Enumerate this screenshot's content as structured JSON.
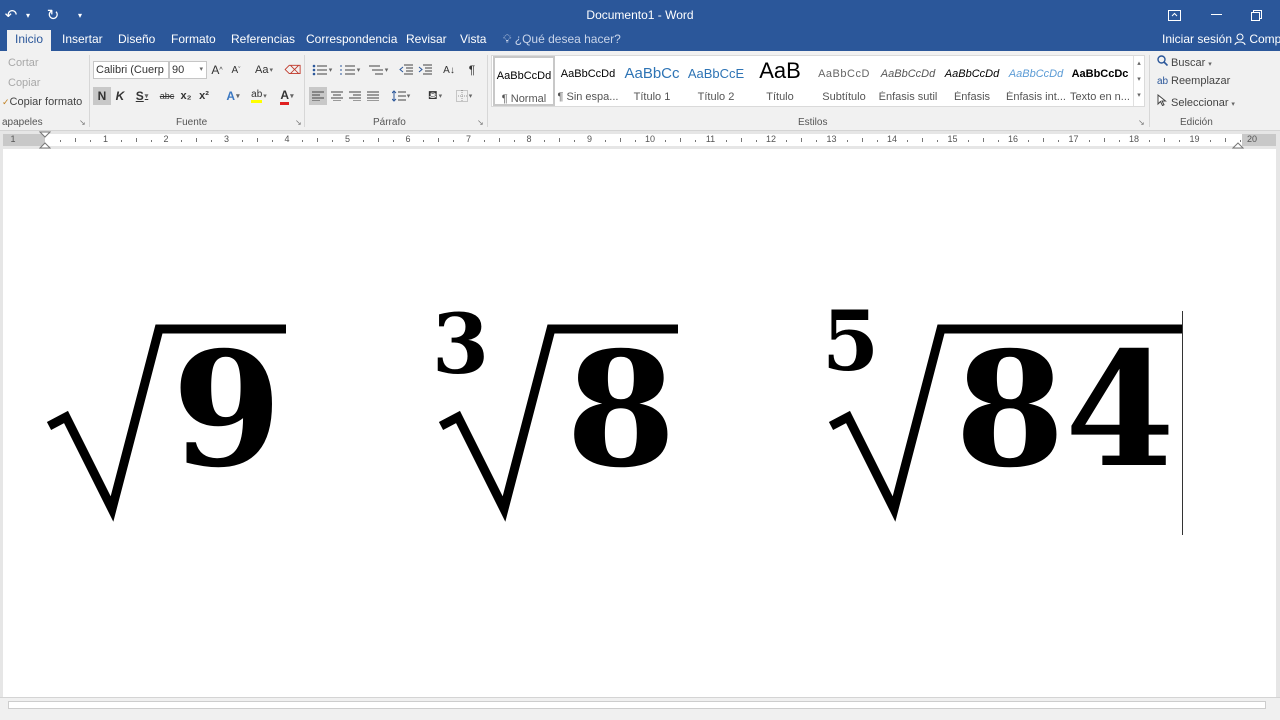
{
  "window": {
    "title": "Documento1 - Word",
    "signin": "Iniciar sesión",
    "share": "Compartir"
  },
  "qat": {
    "undo": "↶",
    "redo": "↻",
    "customize": "▾"
  },
  "tabs": [
    "Inicio",
    "Insertar",
    "Diseño",
    "Formato",
    "Referencias",
    "Correspondencia",
    "Revisar",
    "Vista"
  ],
  "tell_me": "¿Qué desea hacer?",
  "clipboard": {
    "cut": "Cortar",
    "copy": "Copiar",
    "format_painter": "Copiar formato",
    "label": "apapeles"
  },
  "font": {
    "name": "Calibri (Cuerp",
    "size": "90",
    "label": "Fuente",
    "bold": "N",
    "italic": "K",
    "underline": "S",
    "strike": "abc",
    "subscript": "x₂",
    "superscript": "x²",
    "grow": "A",
    "shrink": "A",
    "case": "Aa",
    "effects": "A",
    "highlight": "ab",
    "color": "A"
  },
  "paragraph": {
    "label": "Párrafo",
    "pilcrow": "¶"
  },
  "styles": {
    "label": "Estilos",
    "items": [
      {
        "sample": "AaBbCcDd",
        "name": "¶ Normal"
      },
      {
        "sample": "AaBbCcDd",
        "name": "¶ Sin espa..."
      },
      {
        "sample": "AaBbCc",
        "name": "Título 1"
      },
      {
        "sample": "AaBbCcE",
        "name": "Título 2"
      },
      {
        "sample": "AaB",
        "name": "Título"
      },
      {
        "sample": "AaBbCcD",
        "name": "Subtítulo"
      },
      {
        "sample": "AaBbCcDd",
        "name": "Énfasis sutil"
      },
      {
        "sample": "AaBbCcDd",
        "name": "Énfasis"
      },
      {
        "sample": "AaBbCcDd",
        "name": "Énfasis int..."
      },
      {
        "sample": "AaBbCcDc",
        "name": "Texto en n..."
      }
    ]
  },
  "editing": {
    "label": "Edición",
    "find": "Buscar",
    "replace": "Reemplazar",
    "select": "Seleccionar"
  },
  "ruler": {
    "numbers": [
      "1",
      "1",
      "2",
      "3",
      "4",
      "5",
      "6",
      "7",
      "8",
      "9",
      "10",
      "11",
      "12",
      "13",
      "14",
      "15",
      "16",
      "17",
      "18",
      "19",
      "20"
    ]
  },
  "document": {
    "expressions": [
      {
        "index": "",
        "radicand": "9"
      },
      {
        "index": "3",
        "radicand": "8"
      },
      {
        "index": "5",
        "radicand": "84"
      }
    ]
  },
  "colors": {
    "brand": "#2b579a",
    "ribbon": "#f1f1f1",
    "text": "#000000"
  }
}
